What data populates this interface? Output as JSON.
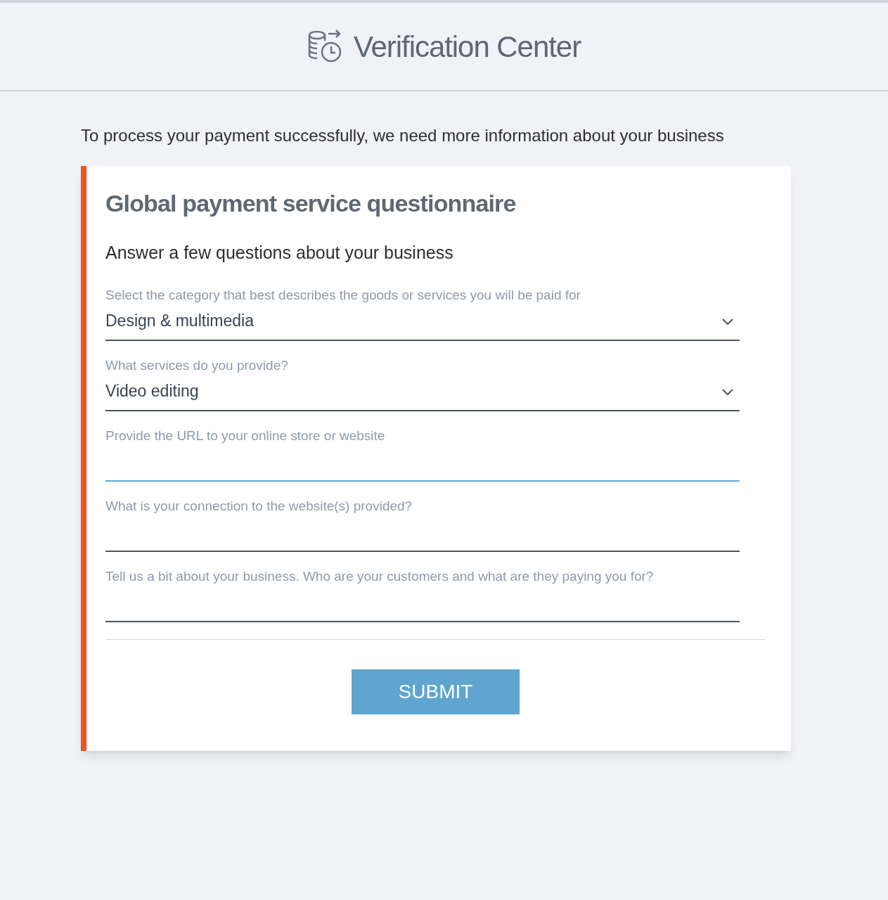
{
  "header": {
    "title": "Verification Center"
  },
  "intro": "To process your payment successfully, we need more information about your business",
  "card": {
    "title": "Global payment service questionnaire",
    "subtitle": "Answer a few questions about your business",
    "fields": [
      {
        "kind": "select",
        "label": "Select the category that best describes the goods or services you will be paid for",
        "value": "Design & multimedia",
        "focused": false
      },
      {
        "kind": "select",
        "label": "What services do you provide?",
        "value": "Video editing",
        "focused": false
      },
      {
        "kind": "text",
        "label": "Provide the URL to your online store or website",
        "focused": true
      },
      {
        "kind": "text",
        "label": "What is your connection to the website(s) provided?",
        "focused": false
      },
      {
        "kind": "text",
        "label": "Tell us a bit about your business. Who are your customers and what are they paying you for?",
        "focused": false
      }
    ],
    "submit": "SUBMIT"
  }
}
